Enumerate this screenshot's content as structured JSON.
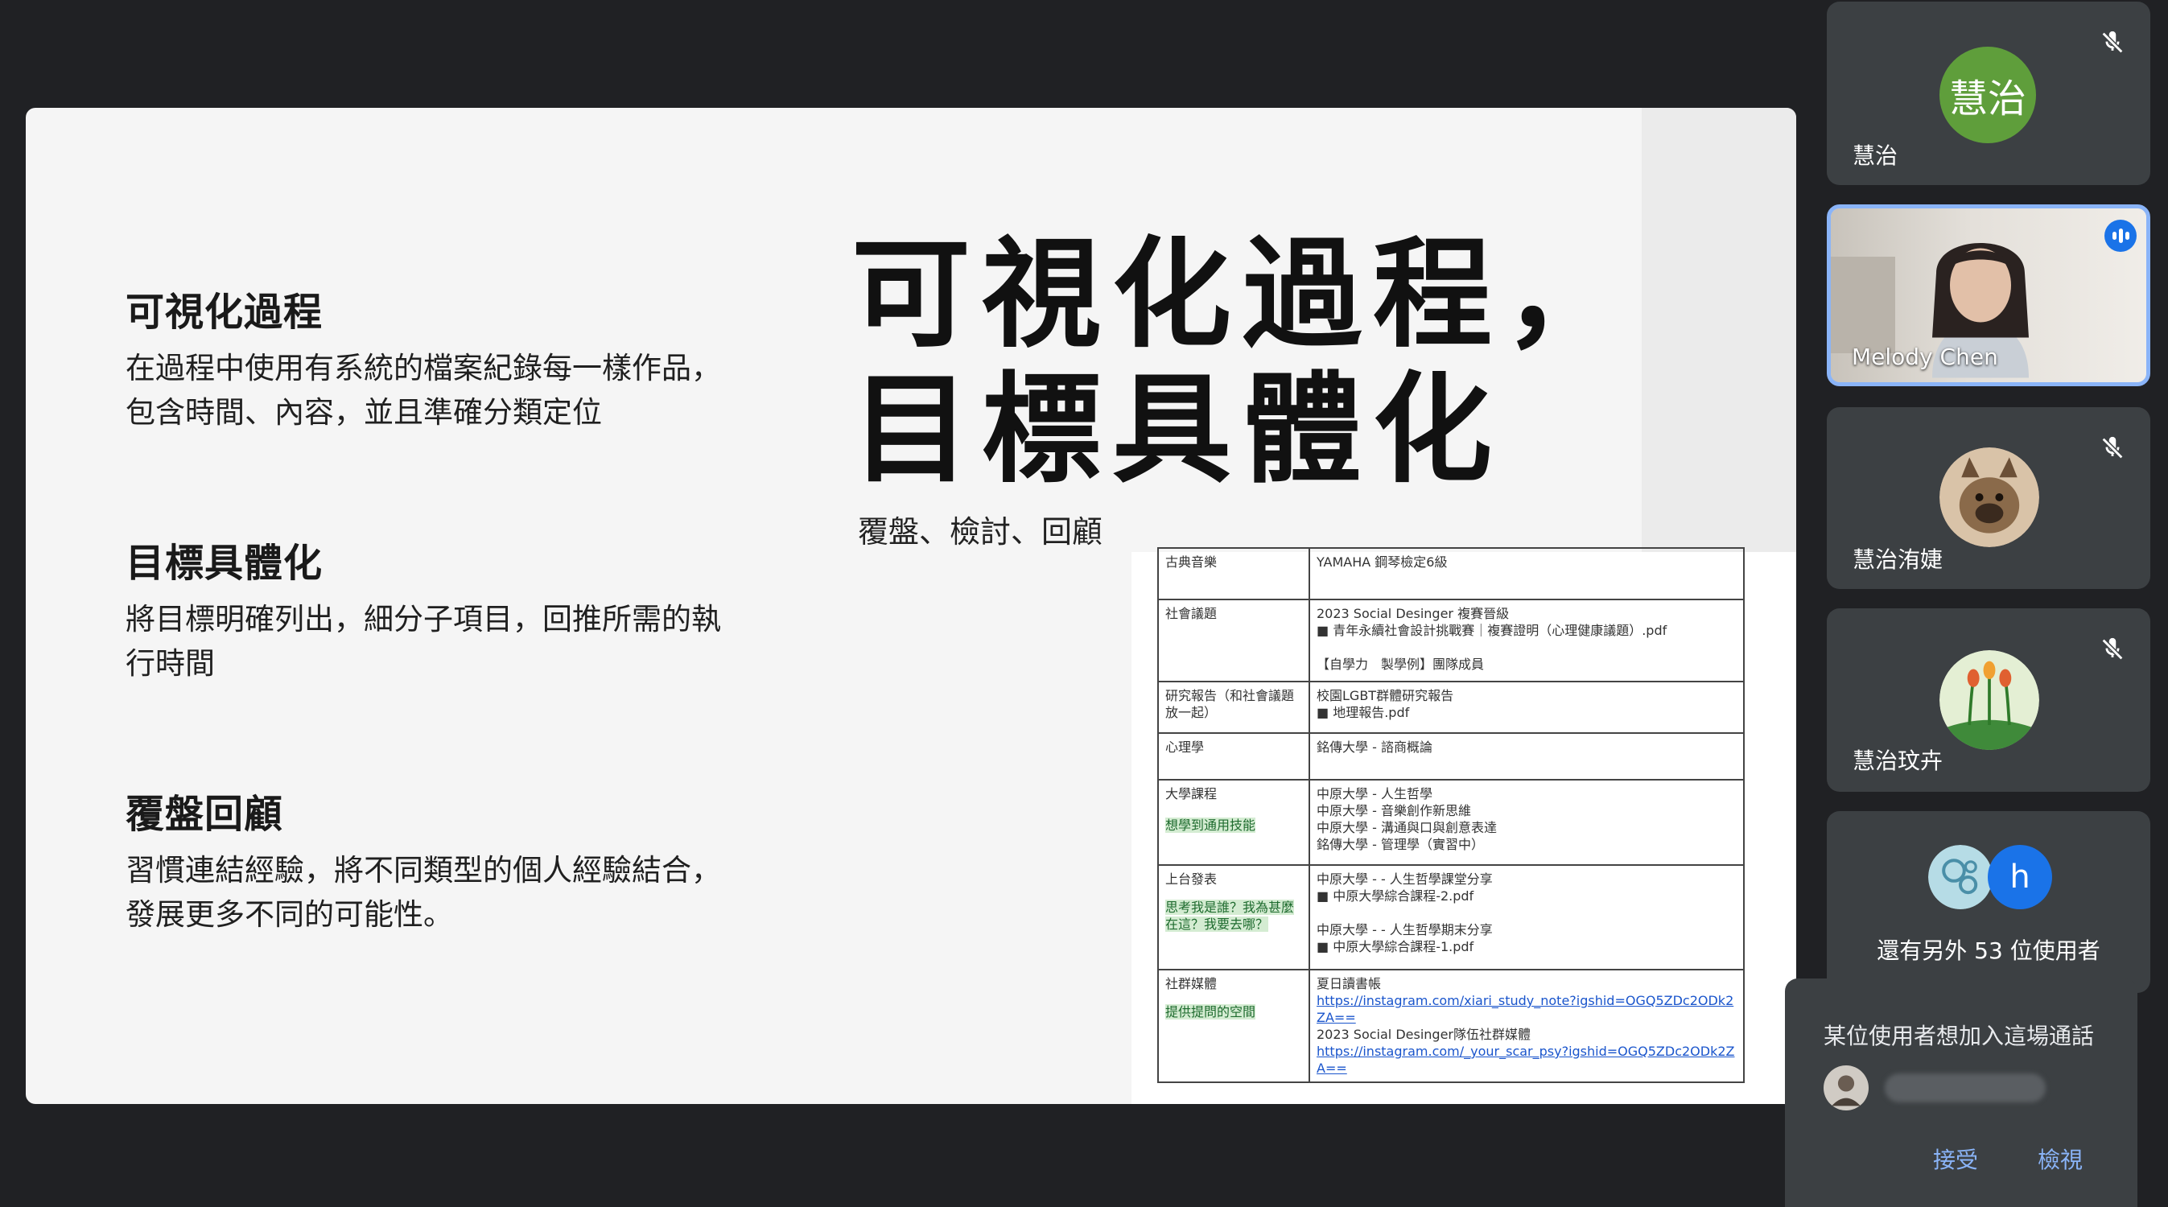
{
  "slide": {
    "sections": [
      {
        "title": "可視化過程",
        "body": "在過程中使用有系統的檔案紀錄每一樣作品，包含時間、內容，並且準確分類定位"
      },
      {
        "title": "目標具體化",
        "body": "將目標明確列出，細分子項目，回推所需的執行時間"
      },
      {
        "title": "覆盤回顧",
        "body": "習慣連結經驗，將不同類型的個人經驗結合，發展更多不同的可能性。"
      }
    ],
    "main_title_line1": "可視化過程，",
    "main_title_line2": "目標具體化",
    "main_subtitle": "覆盤、檢討、回顧"
  },
  "document": {
    "rows": [
      {
        "category": "古典音樂",
        "content": [
          "YAMAHA 鋼琴檢定6級"
        ]
      },
      {
        "category": "社會議題",
        "content": [
          "2023 Social Desinger 複賽晉級",
          "■ 青年永續社會設計挑戰賽｜複賽證明（心理健康議題）.pdf",
          "",
          "【自學力　製學例】團隊成員"
        ]
      },
      {
        "category": "研究報告（和社會議題放一起）",
        "content": [
          "校園LGBT群體研究報告",
          "■ 地理報告.pdf"
        ]
      },
      {
        "category": "心理學",
        "content": [
          "銘傳大學 - 諮商概論"
        ]
      },
      {
        "category": "大學課程",
        "tag": "想學到通用技能",
        "content": [
          "中原大學 - 人生哲學",
          "中原大學 - 音樂創作新思維",
          "中原大學 - 溝通與口與創意表達",
          "銘傳大學 - 管理學（實習中）"
        ]
      },
      {
        "category": "上台發表",
        "tag": "思考我是誰？我為甚麼在這？我要去哪？",
        "content": [
          "中原大學 - - 人生哲學課堂分享",
          "■ 中原大學綜合課程-2.pdf",
          "",
          "中原大學 - - 人生哲學期末分享",
          "■ 中原大學綜合課程-1.pdf"
        ]
      },
      {
        "category": "社群媒體",
        "tag": "提供提問的空間",
        "content": [
          "夏日讀書帳"
        ],
        "link1": "https://instagram.com/xiari_study_note?igshid=OGQ5ZDc2ODk2ZA==",
        "content2": "2023 Social Desinger隊伍社群媒體",
        "link2": "https://instagram.com/_your_scar_psy?igshid=OGQ5ZDc2ODk2ZA=="
      }
    ]
  },
  "participants": {
    "p1": {
      "name": "慧治",
      "avatar_text": "慧治",
      "avatar_color": "#5f9e3b"
    },
    "p2": {
      "name": "Melody Chen",
      "speaking_color": "#8ab4f8"
    },
    "p3": {
      "name": "慧治洧婕"
    },
    "p4": {
      "name": "慧治玟卉"
    },
    "others": {
      "label": "還有另外 53 位使用者",
      "avatar_letter": "h",
      "avatar_color": "#1a73e8"
    }
  },
  "join_request": {
    "message": "某位使用者想加入這場通話",
    "accept_label": "接受",
    "view_label": "檢視"
  }
}
